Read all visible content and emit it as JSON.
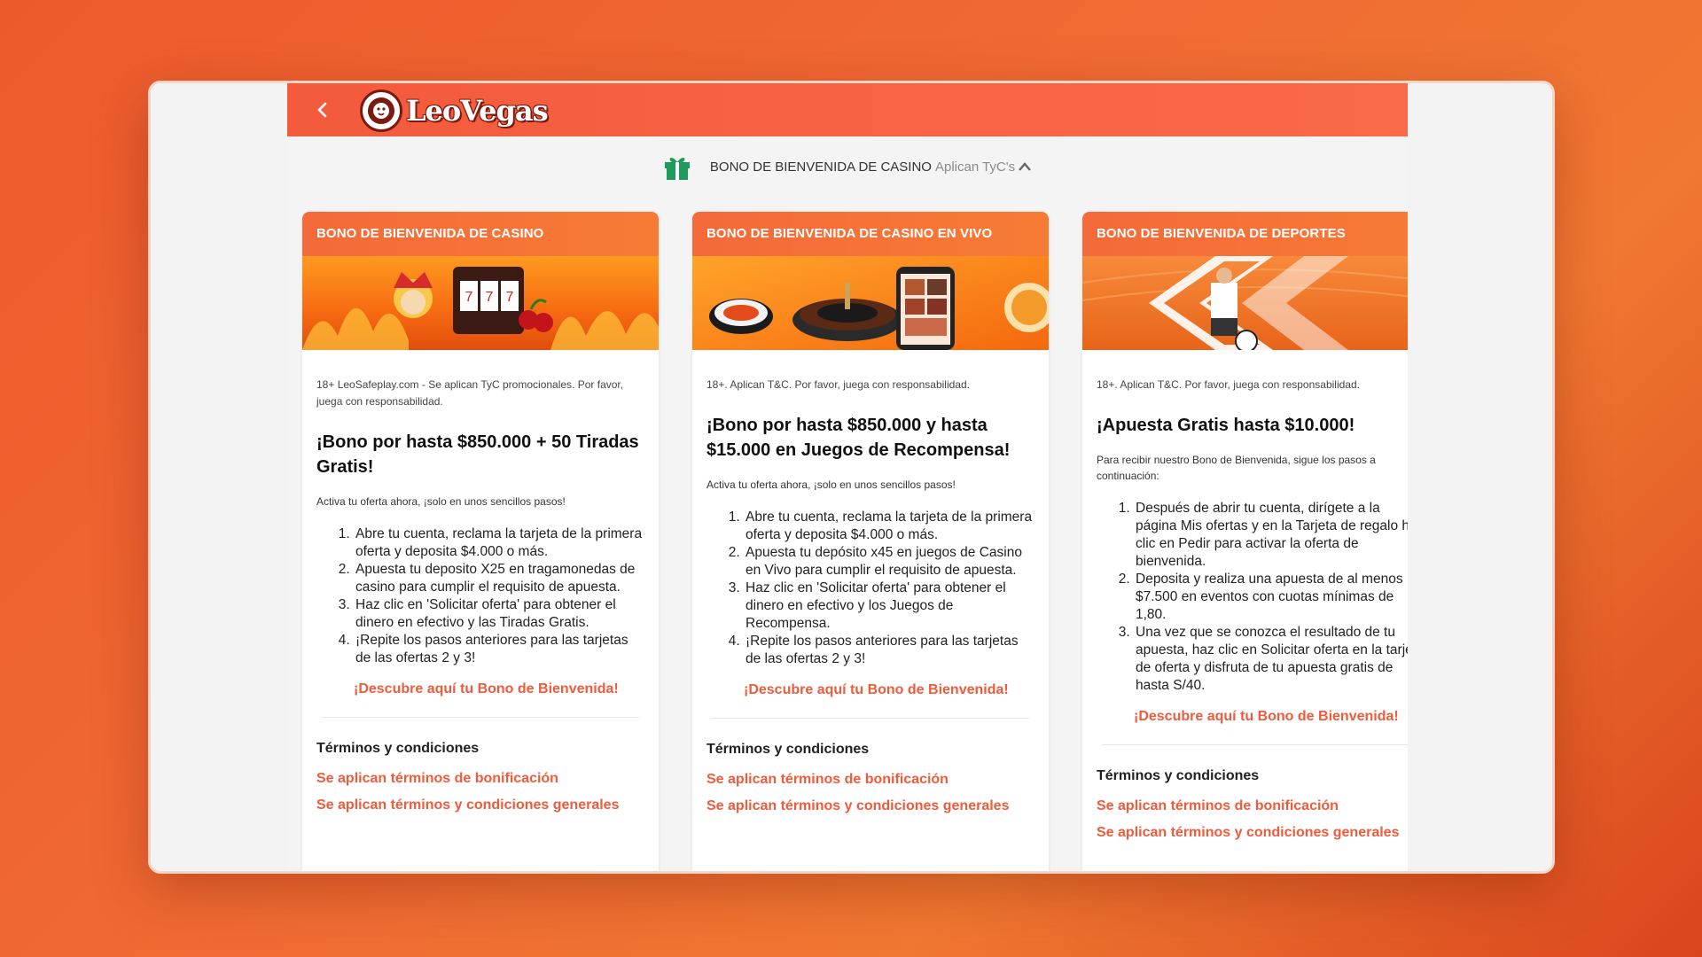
{
  "header": {
    "logo_text": "LeoVegas",
    "back_label": "‹"
  },
  "bonus_bar": {
    "title": "BONO DE BIENVENIDA DE CASINO",
    "tyc": "Aplican TyC's"
  },
  "cards": [
    {
      "header": "BONO DE BIENVENIDA DE CASINO",
      "legal": "18+ LeoSafeplay.com - Se aplican TyC promocionales. Por favor, juega con responsabilidad.",
      "headline": "¡Bono por hasta $850.000 + 50 Tiradas Gratis!",
      "intro": "Activa tu oferta ahora, ¡solo en unos sencillos pasos!",
      "steps": [
        "Abre tu cuenta, reclama la tarjeta de la primera oferta y deposita $4.000 o más.",
        "Apuesta tu deposito X25 en tragamonedas de casino para cumplir el requisito de apuesta.",
        "Haz clic en 'Solicitar oferta' para obtener el dinero en efectivo y las Tiradas Gratis.",
        "¡Repite los pasos anteriores para las tarjetas de las ofertas 2 y 3!"
      ],
      "cta": "¡Descubre aquí tu Bono de Bienvenida!",
      "terms_title": "Términos y condiciones",
      "terms_link_1": "Se aplican términos de bonificación",
      "terms_link_2": "Se aplican términos y condiciones generales"
    },
    {
      "header": "BONO DE BIENVENIDA DE CASINO EN VIVO",
      "legal": "18+. Aplican T&C. Por favor, juega con responsabilidad.",
      "headline": "¡Bono por hasta $850.000 y hasta $15.000 en Juegos de Recompensa!",
      "intro": "Activa tu oferta ahora, ¡solo en unos sencillos pasos!",
      "steps": [
        "Abre tu cuenta, reclama la tarjeta de la primera oferta y deposita $4.000 o más.",
        "Apuesta tu depósito x45 en juegos de Casino en Vivo para cumplir el requisito de apuesta.",
        "Haz clic en 'Solicitar oferta' para obtener el dinero en efectivo y los Juegos de Recompensa.",
        "¡Repite los pasos anteriores para las tarjetas de las ofertas 2 y 3!"
      ],
      "cta": "¡Descubre aquí tu Bono de Bienvenida!",
      "terms_title": "Términos y condiciones",
      "terms_link_1": "Se aplican términos de bonificación",
      "terms_link_2": "Se aplican términos y condiciones generales"
    },
    {
      "header": "BONO DE BIENVENIDA DE DEPORTES",
      "legal": "18+. Aplican T&C. Por favor, juega con responsabilidad.",
      "headline": "¡Apuesta Gratis hasta $10.000!",
      "intro": "Para recibir nuestro Bono de Bienvenida, sigue los pasos a continuación:",
      "steps": [
        "Después de abrir tu cuenta, dirígete a la página Mis ofertas y en la Tarjeta de regalo haz clic en Pedir para activar la oferta de bienvenida.",
        "Deposita y realiza una apuesta de al menos $7.500 en eventos con cuotas mínimas de 1,80.",
        "Una vez que se conozca el resultado de tu apuesta, haz clic en Solicitar oferta en la tarjeta de oferta y disfruta de tu apuesta gratis de hasta S/40."
      ],
      "cta": "¡Descubre aquí tu Bono de Bienvenida!",
      "terms_title": "Términos y condiciones",
      "terms_link_1": "Se aplican términos de bonificación",
      "terms_link_2": "Se aplican términos y condiciones generales"
    }
  ]
}
